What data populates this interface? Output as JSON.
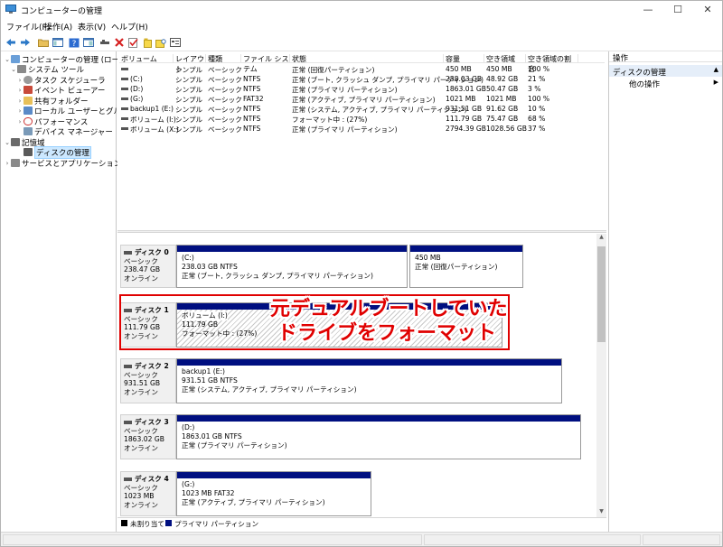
{
  "window": {
    "title": "コンピューターの管理",
    "min": "—",
    "max": "☐",
    "close": "✕"
  },
  "menu": [
    "ファイル(F)",
    "操作(A)",
    "表示(V)",
    "ヘルプ(H)"
  ],
  "toolbar_icons": [
    "back-arrow-icon",
    "forward-arrow-icon",
    "folder-icon",
    "panel-icon",
    "help-icon",
    "panel2-icon",
    "connect-icon",
    "delete-icon",
    "check-icon",
    "new-icon",
    "folder-search-icon",
    "properties-icon"
  ],
  "tree": {
    "root": "コンピューターの管理 (ローカル)",
    "system_tools": "システム ツール",
    "task_scheduler": "タスク スケジューラ",
    "event_viewer": "イベント ビューアー",
    "shared_folders": "共有フォルダー",
    "local_users": "ローカル ユーザーとグループ",
    "performance": "パフォーマンス",
    "device_manager": "デバイス マネージャー",
    "storage": "記憶域",
    "disk_management": "ディスクの管理",
    "services": "サービスとアプリケーション"
  },
  "volume_table": {
    "headers": [
      "ボリューム",
      "レイアウト",
      "種類",
      "ファイル システム",
      "状態",
      "容量",
      "空き領域",
      "空き領域の割合"
    ],
    "rows": [
      [
        "",
        "シンプル",
        "ベーシック",
        "",
        "正常 (回復パーティション)",
        "450 MB",
        "450 MB",
        "100 %"
      ],
      [
        "(C:)",
        "シンプル",
        "ベーシック",
        "NTFS",
        "正常 (ブート, クラッシュ ダンプ, プライマリ パーティション)",
        "238.03 GB",
        "48.92 GB",
        "21 %"
      ],
      [
        "(D:)",
        "シンプル",
        "ベーシック",
        "NTFS",
        "正常 (プライマリ パーティション)",
        "1863.01 GB",
        "50.47 GB",
        "3 %"
      ],
      [
        "(G:)",
        "シンプル",
        "ベーシック",
        "FAT32",
        "正常 (アクティブ, プライマリ パーティション)",
        "1021 MB",
        "1021 MB",
        "100 %"
      ],
      [
        "backup1 (E:)",
        "シンプル",
        "ベーシック",
        "NTFS",
        "正常 (システム, アクティブ, プライマリ パーティション)",
        "931.51 GB",
        "91.62 GB",
        "10 %"
      ],
      [
        "ボリューム (I:)",
        "シンプル",
        "ベーシック",
        "NTFS",
        "フォーマット中 : (27%)",
        "111.79 GB",
        "75.47 GB",
        "68 %"
      ],
      [
        "ボリューム (X:)",
        "シンプル",
        "ベーシック",
        "NTFS",
        "正常 (プライマリ パーティション)",
        "2794.39 GB",
        "1028.56 GB",
        "37 %"
      ]
    ]
  },
  "disks": [
    {
      "name": "ディスク 0",
      "type": "ベーシック",
      "size": "238.47 GB",
      "status": "オンライン",
      "parts": [
        {
          "title": "(C:)",
          "size": "238.03 GB NTFS",
          "state": "正常 (ブート, クラッシュ ダンプ, プライマリ パーティション)"
        },
        {
          "title": "",
          "size": "450 MB",
          "state": "正常 (回復パーティション)"
        }
      ]
    },
    {
      "name": "ディスク 1",
      "type": "ベーシック",
      "size": "111.79 GB",
      "status": "オンライン",
      "parts": [
        {
          "title": "ボリューム (I:)",
          "size": "111.79 GB",
          "state": "フォーマット中 : (27%)"
        }
      ]
    },
    {
      "name": "ディスク 2",
      "type": "ベーシック",
      "size": "931.51 GB",
      "status": "オンライン",
      "parts": [
        {
          "title": "backup1 (E:)",
          "size": "931.51 GB NTFS",
          "state": "正常 (システム, アクティブ, プライマリ パーティション)"
        }
      ]
    },
    {
      "name": "ディスク 3",
      "type": "ベーシック",
      "size": "1863.02 GB",
      "status": "オンライン",
      "parts": [
        {
          "title": "(D:)",
          "size": "1863.01 GB NTFS",
          "state": "正常 (プライマリ パーティション)"
        }
      ]
    },
    {
      "name": "ディスク 4",
      "type": "ベーシック",
      "size": "1023 MB",
      "status": "オンライン",
      "parts": [
        {
          "title": "(G:)",
          "size": "1023 MB FAT32",
          "state": "正常 (アクティブ, プライマリ パーティション)"
        }
      ]
    }
  ],
  "legend": {
    "unallocated": "未割り当て",
    "primary": "プライマリ パーティション"
  },
  "actions": {
    "header": "操作",
    "section": "ディスクの管理",
    "other": "他の操作"
  },
  "annotation": {
    "line1": "元デュアルブートしていた",
    "line2": "ドライブをフォーマット"
  },
  "colors": {
    "partition_bar": "#000f80",
    "annotation": "#e00000",
    "selection": "#cce8ff"
  }
}
